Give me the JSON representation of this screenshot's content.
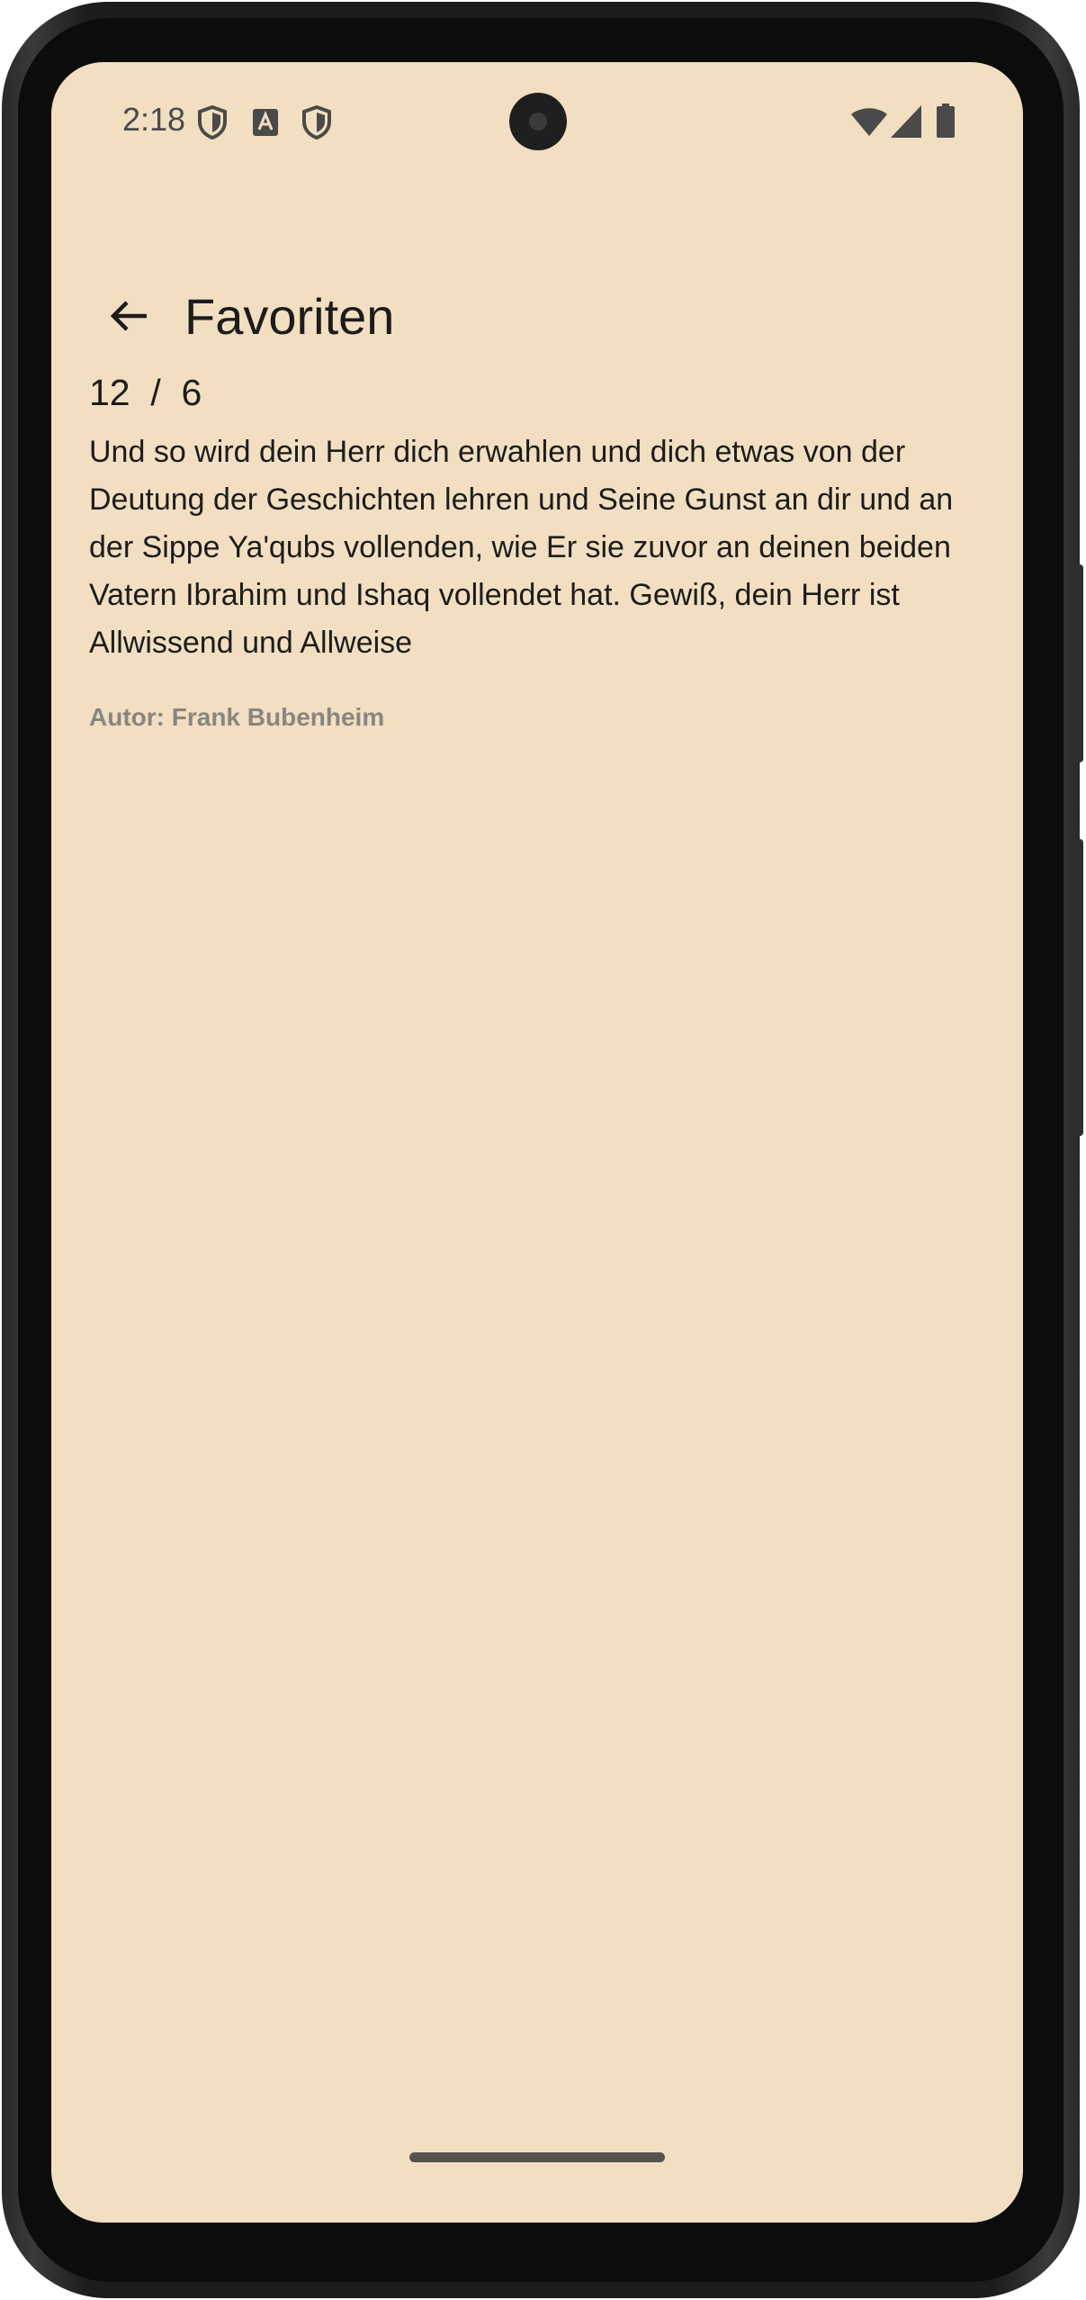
{
  "status_bar": {
    "time": "2:18",
    "icons_left": [
      "shield-icon",
      "a-badge-icon",
      "shield-icon"
    ],
    "icons_right": [
      "wifi-icon",
      "signal-icon",
      "battery-icon"
    ]
  },
  "app_bar": {
    "back_icon": "arrow-back-icon",
    "title": "Favoriten"
  },
  "favorite": {
    "reference": "12  /  6",
    "text": "Und so wird dein Herr dich erwahlen und dich etwas von der Deutung der Geschichten lehren und Seine Gunst an dir und an der Sippe Ya'qubs vollenden, wie Er sie zuvor an deinen beiden Vatern Ibrahim und Ishaq vollendet hat. Gewiß, dein Herr ist Allwissend und Allweise",
    "author": "Autor: Frank Bubenheim"
  },
  "colors": {
    "background": "#f2dfc1",
    "text": "#1c1c1c",
    "muted": "#8a8580"
  }
}
